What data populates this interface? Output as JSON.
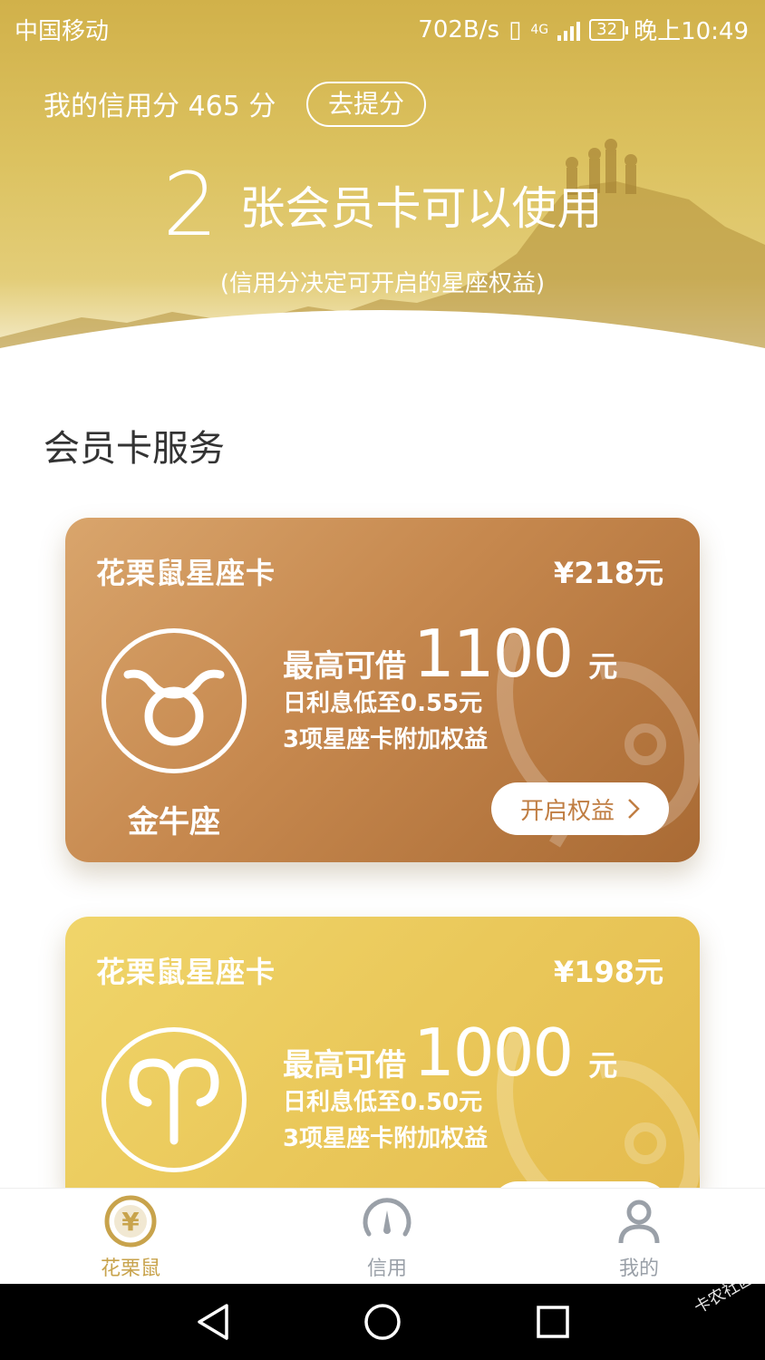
{
  "status_bar": {
    "carrier": "中国移动",
    "speed": "702B/s",
    "network": "4G",
    "battery": "32",
    "time": "晚上10:49"
  },
  "header": {
    "score_label": "我的信用分 465 分",
    "boost_label": "去提分",
    "card_count": "2",
    "card_count_text": "张会员卡可以使用",
    "subtitle": "(信用分决定可开启的星座权益)"
  },
  "section": {
    "title": "会员卡服务"
  },
  "cards": [
    {
      "name": "花栗鼠星座卡",
      "price": "¥218元",
      "zodiac": "金牛座",
      "limit_label": "最高可借",
      "limit_amount": "1100",
      "limit_unit": "元",
      "rate": "日利息低至0.55元",
      "benefits": "3项星座卡附加权益",
      "button_label": "开启权益"
    },
    {
      "name": "花栗鼠星座卡",
      "price": "¥198元",
      "limit_label": "最高可借",
      "limit_amount": "1000",
      "limit_unit": "元",
      "rate": "日利息低至0.50元",
      "benefits": "3项星座卡附加权益"
    }
  ],
  "tabbar": {
    "items": [
      {
        "label": "花栗鼠",
        "icon": "yen-icon",
        "active": true
      },
      {
        "label": "信用",
        "icon": "gauge-icon",
        "active": false
      },
      {
        "label": "我的",
        "icon": "user-icon",
        "active": false
      }
    ]
  },
  "watermark": "卡农社区",
  "colors": {
    "header_gold": "#d1b14a",
    "card1_bronze": "#c6884e",
    "card2_gold": "#eac85a",
    "tab_active": "#c8a34c",
    "tab_inactive": "#9aa0a8"
  }
}
